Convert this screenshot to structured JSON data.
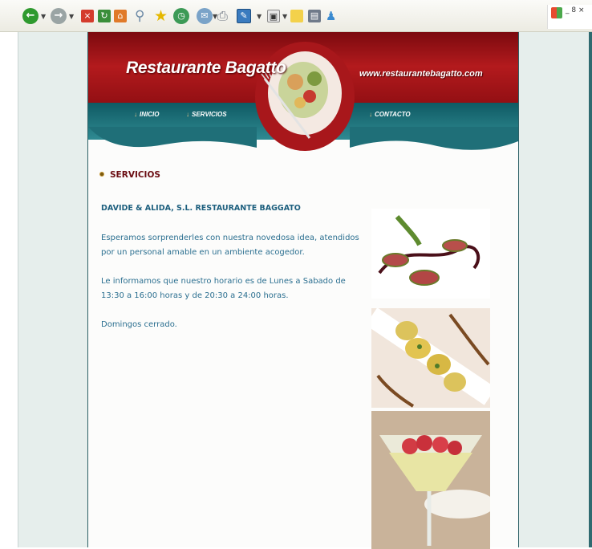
{
  "browser": {
    "toolbar_icons": [
      "back-icon",
      "forward-icon",
      "stop-icon",
      "refresh-icon",
      "home-icon",
      "search-icon",
      "favorites-icon",
      "history-icon",
      "mail-icon",
      "print-icon",
      "edit-icon",
      "messenger-icon",
      "notes-icon",
      "research-icon",
      "windows-messenger-icon"
    ],
    "window_controls": "_ 8 ×"
  },
  "site": {
    "brand": "Restaurante Bagatto",
    "url": "www.restaurantebagatto.com",
    "nav": [
      "INICIO",
      "SERVICIOS",
      "CONTACTO"
    ],
    "section_title": "SERVICIOS",
    "company": "DAVIDE & ALIDA, S.L. RESTAURANTE BAGGATO",
    "paragraphs": [
      "Esperamos sorprenderles con nuestra novedosa idea, atendidos por un personal amable en un ambiente acogedor.",
      "Le informamos que nuestro horario es de Lunes a Sabado de 13:30 a 16:00 horas y de 20:30 a 24:00 horas.",
      "Domingos cerrado."
    ]
  },
  "colors": {
    "brand_red": "#b31a1d",
    "brand_teal": "#2f8a92",
    "text_blue": "#2b6f90"
  }
}
